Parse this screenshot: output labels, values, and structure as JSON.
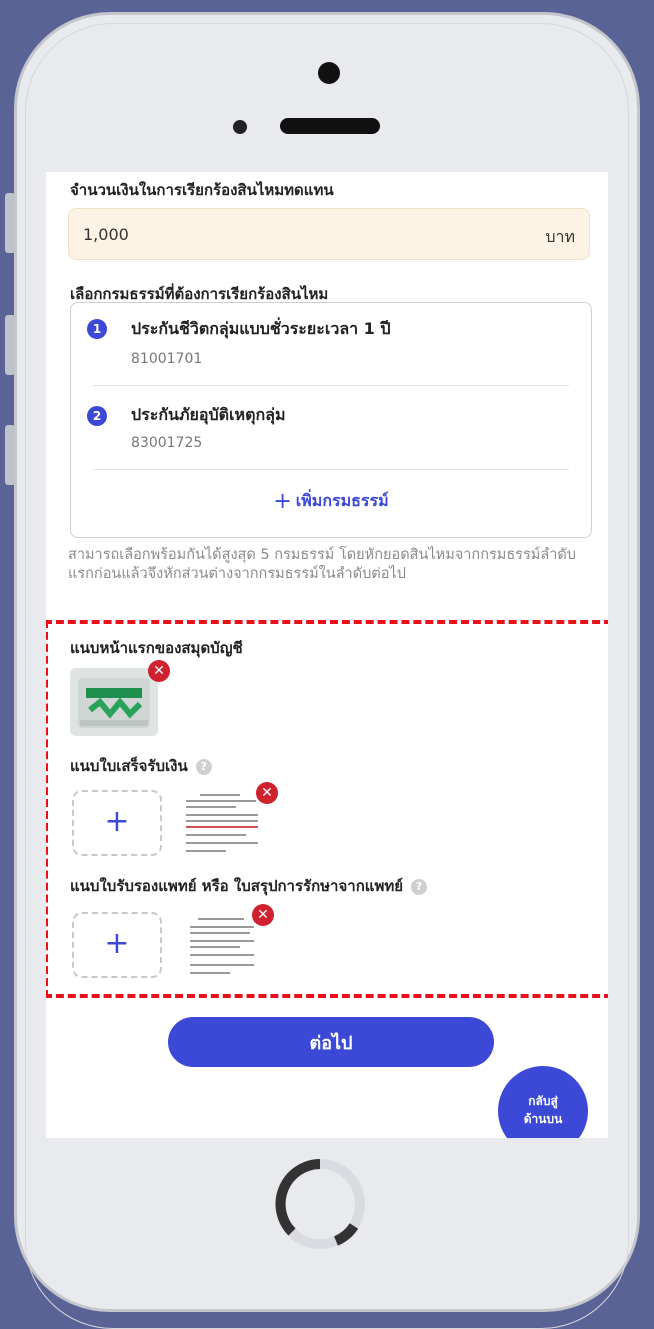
{
  "claim": {
    "amount_label": "จำนวนเงินในการเรียกร้องสินไหมทดแทน",
    "amount_value": "1,000",
    "amount_unit": "บาท"
  },
  "policies": {
    "label": "เลือกกรมธรรม์ที่ต้องการเรียกร้องสินไหม",
    "items": [
      {
        "number": "1",
        "name": "ประกันชีวิตกลุ่มแบบชั่วระยะเวลา 1 ปี",
        "code": "81001701"
      },
      {
        "number": "2",
        "name": "ประกันภัยอุบัติเหตุกลุ่ม",
        "code": "83001725"
      }
    ],
    "add_label": "เพิ่มกรมธรรม์",
    "add_icon": "+",
    "note": "สามารถเลือกพร้อมกันได้สูงสุด 5 กรมธรรม์ โดยหักยอดสินไหมจากกรมธรรม์ลำดับแรกก่อนแล้วจึงหักส่วนต่างจากกรมธรรม์ในลำดับต่อไป"
  },
  "attachments": {
    "bankbook_label": "แนบหน้าแรกของสมุดบัญชี",
    "receipt_label": "แนบใบเสร็จรับเงิน",
    "medical_label": "แนบใบรับรองแพทย์ หรือ ใบสรุปการรักษาจากแพทย์",
    "help_icon": "?",
    "remove_icon": "✕",
    "add_icon": "+"
  },
  "actions": {
    "next_label": "ต่อไป",
    "back_top_line1": "กลับสู่",
    "back_top_line2": "ด้านบน"
  },
  "colors": {
    "accent": "#3c48d6",
    "highlight_border": "#e8111a",
    "remove": "#d0212e",
    "amount_bg": "#fdf3e4"
  }
}
